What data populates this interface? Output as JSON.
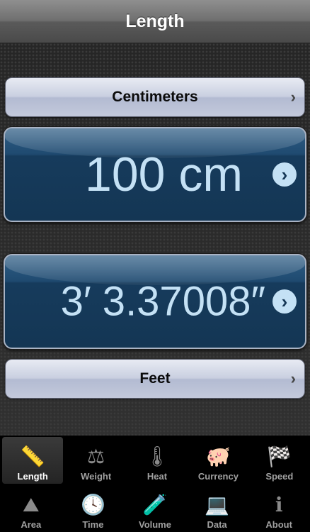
{
  "header": {
    "title": "Length"
  },
  "from_unit": {
    "label": "Centimeters",
    "chevron": "›"
  },
  "from_value": {
    "text": "100 cm",
    "arrow": "›"
  },
  "to_value": {
    "text": "3′ 3.37008″",
    "arrow": "›"
  },
  "to_unit": {
    "label": "Feet",
    "chevron": "›"
  },
  "tabs_row1": [
    {
      "label": "Length",
      "icon": "ruler-icon",
      "glyph": "📏",
      "active": true
    },
    {
      "label": "Weight",
      "icon": "scale-icon",
      "glyph": "⚖",
      "active": false
    },
    {
      "label": "Heat",
      "icon": "thermometer-icon",
      "glyph": "🌡",
      "active": false
    },
    {
      "label": "Currency",
      "icon": "piggy-bank-icon",
      "glyph": "🐖",
      "active": false
    },
    {
      "label": "Speed",
      "icon": "checkered-flag-icon",
      "glyph": "🏁",
      "active": false
    }
  ],
  "tabs_row2": [
    {
      "label": "Area",
      "icon": "hills-icon",
      "glyph": "⛰",
      "active": false
    },
    {
      "label": "Time",
      "icon": "clock-icon",
      "glyph": "🕓",
      "active": false
    },
    {
      "label": "Volume",
      "icon": "beaker-icon",
      "glyph": "🧪",
      "active": false
    },
    {
      "label": "Data",
      "icon": "laptop-icon",
      "glyph": "💻",
      "active": false
    },
    {
      "label": "About",
      "icon": "info-icon",
      "glyph": "ℹ",
      "active": false
    }
  ],
  "colors": {
    "value_text": "#c4e1f5",
    "value_bg": "#143654",
    "active_tab_label": "#ffffff",
    "inactive_tab_label": "#a0a0a0"
  }
}
